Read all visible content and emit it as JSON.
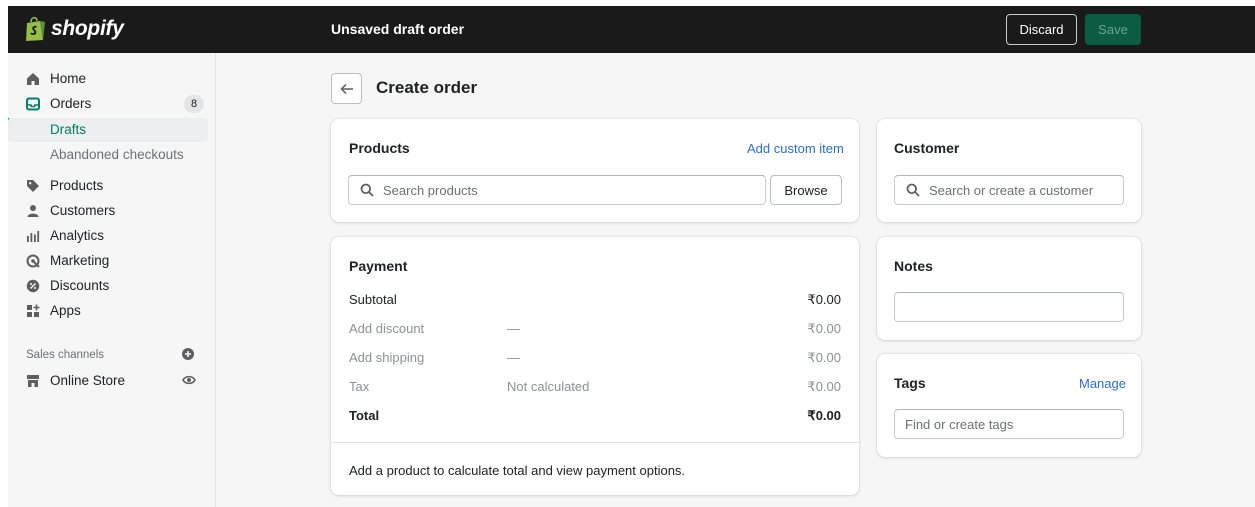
{
  "app": {
    "brand": "shopify",
    "title": "Unsaved draft order"
  },
  "actions": {
    "discard": "Discard",
    "save": "Save"
  },
  "sidebar": {
    "items": [
      {
        "label": "Home",
        "icon": "home-icon"
      },
      {
        "label": "Orders",
        "icon": "orders-icon",
        "badge": "8"
      },
      {
        "label": "Drafts",
        "active": true
      },
      {
        "label": "Abandoned checkouts"
      },
      {
        "label": "Products",
        "icon": "tag-icon"
      },
      {
        "label": "Customers",
        "icon": "person-icon"
      },
      {
        "label": "Analytics",
        "icon": "analytics-icon"
      },
      {
        "label": "Marketing",
        "icon": "marketing-icon"
      },
      {
        "label": "Discounts",
        "icon": "discount-icon"
      },
      {
        "label": "Apps",
        "icon": "apps-icon"
      }
    ],
    "sales_channels_label": "Sales channels",
    "online_store": "Online Store"
  },
  "page": {
    "title": "Create order"
  },
  "products": {
    "title": "Products",
    "add_custom": "Add custom item",
    "search_placeholder": "Search products",
    "browse": "Browse"
  },
  "payment": {
    "title": "Payment",
    "rows": [
      {
        "label": "Subtotal",
        "mid": "",
        "value": "₹0.00"
      },
      {
        "label": "Add discount",
        "mid": "—",
        "value": "₹0.00"
      },
      {
        "label": "Add shipping",
        "mid": "—",
        "value": "₹0.00"
      },
      {
        "label": "Tax",
        "mid": "Not calculated",
        "value": "₹0.00"
      },
      {
        "label": "Total",
        "mid": "",
        "value": "₹0.00"
      }
    ],
    "footnote": "Add a product to calculate total and view payment options."
  },
  "customer": {
    "title": "Customer",
    "search_placeholder": "Search or create a customer"
  },
  "notes": {
    "title": "Notes",
    "value": ""
  },
  "tags": {
    "title": "Tags",
    "manage": "Manage",
    "placeholder": "Find or create tags"
  },
  "colors": {
    "accent": "#008060",
    "topbar": "#1a1a1a",
    "link": "#2c6ecb",
    "save_bg": "#0a5d44"
  }
}
